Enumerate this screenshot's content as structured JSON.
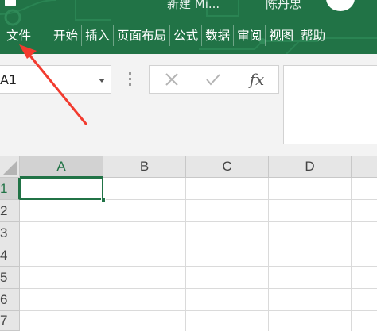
{
  "title": {
    "doc_name": "新建 Mi...",
    "user_name": "陈丹忠"
  },
  "tabs": [
    "文件",
    "开始",
    "插入",
    "页面布局",
    "公式",
    "数据",
    "审阅",
    "视图",
    "帮助"
  ],
  "name_box": {
    "value": "A1"
  },
  "formula_buttons": {
    "cancel_icon": "cross-icon",
    "enter_icon": "check-icon",
    "fx_label": "fx"
  },
  "columns": [
    "A",
    "B",
    "C",
    "D"
  ],
  "rows": [
    "1",
    "2",
    "3",
    "4",
    "5",
    "6",
    "7"
  ],
  "colors": {
    "ribbon": "#217346",
    "selection": "#217346",
    "annotation_arrow": "#f23b2f"
  }
}
